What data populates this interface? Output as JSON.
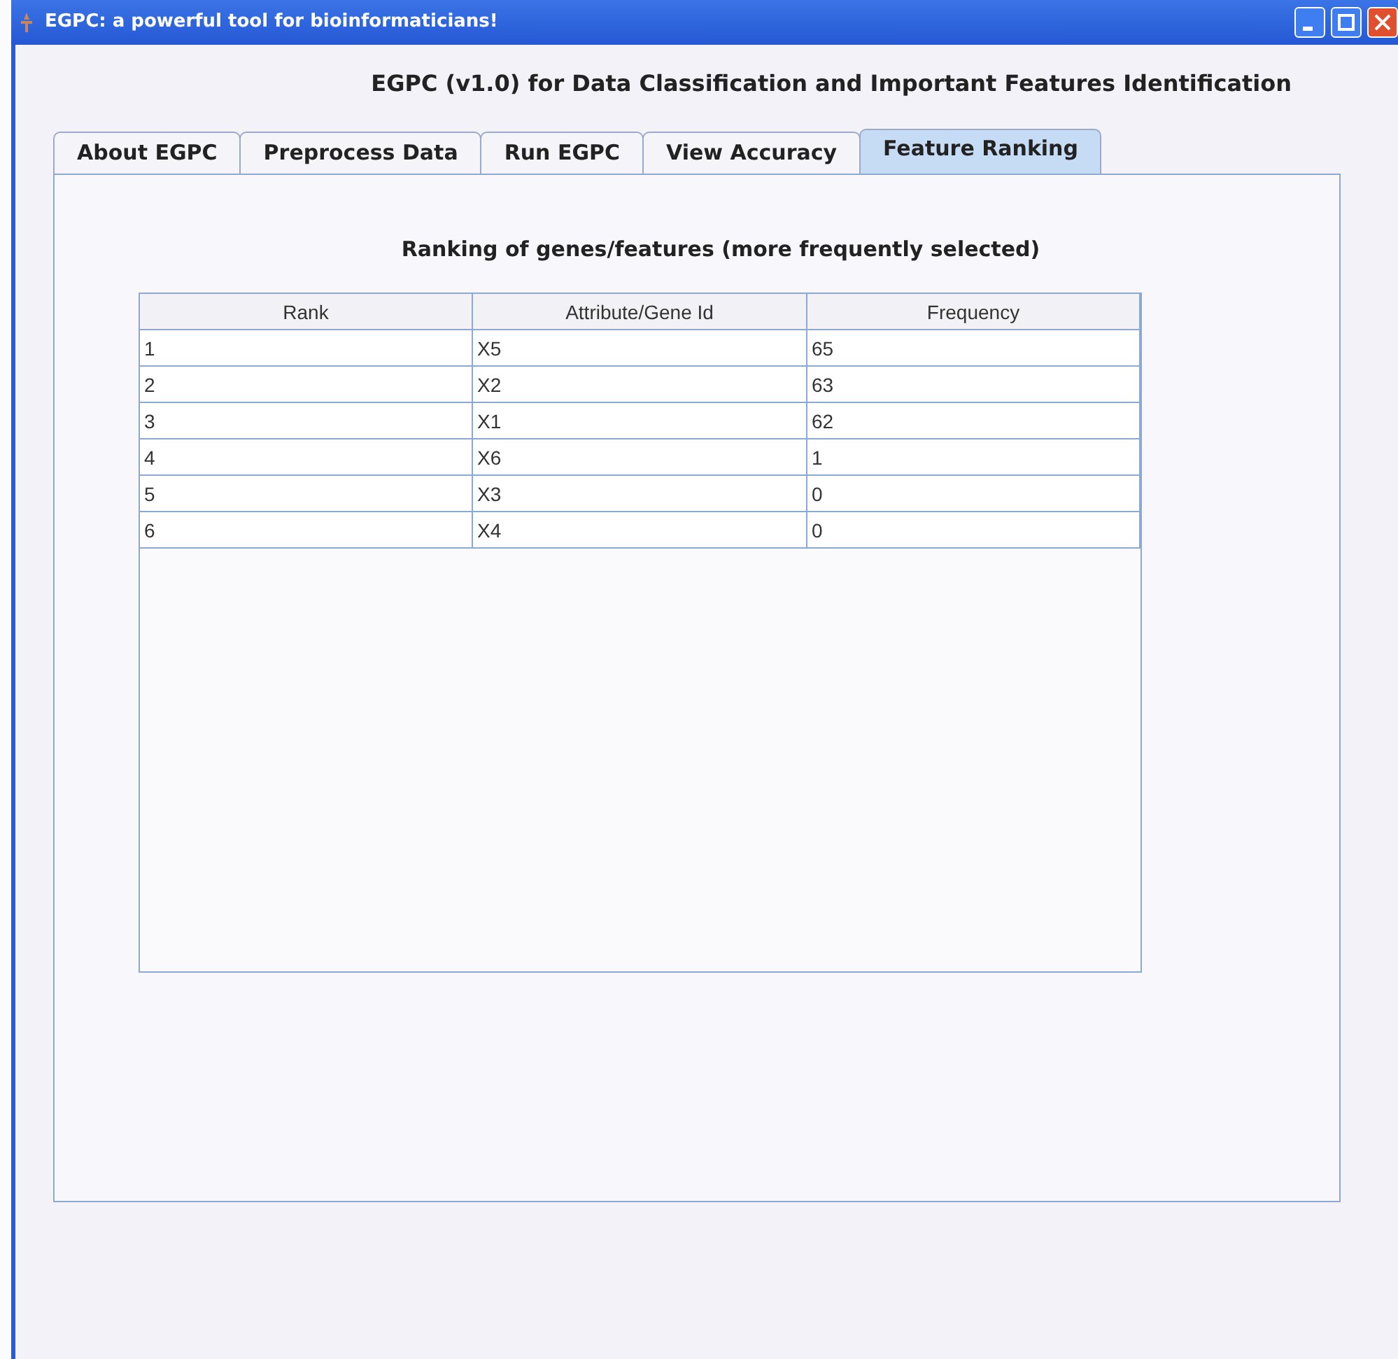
{
  "window": {
    "title": "EGPC: a powerful tool for bioinformaticians!"
  },
  "heading": "EGPC (v1.0) for Data Classification and Important Features Identification",
  "tabs": [
    {
      "label": "About EGPC",
      "selected": false
    },
    {
      "label": "Preprocess Data",
      "selected": false
    },
    {
      "label": "Run EGPC",
      "selected": false
    },
    {
      "label": "View Accuracy",
      "selected": false
    },
    {
      "label": "Feature Ranking",
      "selected": true
    }
  ],
  "panel_title": "Ranking of genes/features (more frequently selected)",
  "table": {
    "columns": [
      "Rank",
      "Attribute/Gene Id",
      "Frequency"
    ],
    "rows": [
      [
        "1",
        "X5",
        "65"
      ],
      [
        "2",
        "X2",
        "63"
      ],
      [
        "3",
        "X1",
        "62"
      ],
      [
        "4",
        "X6",
        "1"
      ],
      [
        "5",
        "X3",
        "0"
      ],
      [
        "6",
        "X4",
        "0"
      ]
    ]
  }
}
